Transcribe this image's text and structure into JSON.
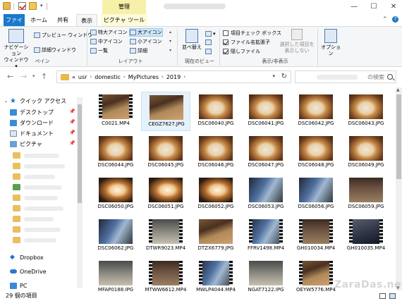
{
  "title_bar": {
    "manage_label": "管理",
    "window_buttons": [
      "—",
      "☐",
      "✕"
    ]
  },
  "ribbon_tabs": [
    {
      "label": "ファイル"
    },
    {
      "label": "ホーム"
    },
    {
      "label": "共有"
    },
    {
      "label": "表示"
    },
    {
      "label": "ピクチャ ツール"
    }
  ],
  "ribbon": {
    "pane_group": {
      "nav_pane": "ナビゲーション\nウィンドウ▾",
      "preview": "プレビュー ウィンドウ",
      "details": "詳細ウィンドウ",
      "label": "ペイン"
    },
    "layout_group": {
      "items": [
        "特大アイコン",
        "大アイコン",
        "中アイコン",
        "小アイコン",
        "一覧",
        "詳細"
      ],
      "label": "レイアウト"
    },
    "current_view_group": {
      "sort": "並べ替え",
      "label": "現在のビュー"
    },
    "show_hide_group": {
      "items": [
        {
          "label": "項目チェック ボックス",
          "checked": false
        },
        {
          "label": "ファイル名拡張子",
          "checked": true
        },
        {
          "label": "隠しファイル",
          "checked": true
        }
      ],
      "hide_selected": "選択した項目を\n表示しない",
      "label": "表示/非表示"
    },
    "options": "オプション"
  },
  "address": {
    "breadcrumbs": [
      "«",
      "usr",
      "domestic",
      "MyPictures",
      "2019"
    ],
    "search_placeholder": "の検索"
  },
  "nav_pane": {
    "quick_access": "クイック アクセス",
    "pinned": [
      {
        "label": "デスクトップ",
        "icon": "desktop-icon"
      },
      {
        "label": "ダウンロード",
        "icon": "download-icon"
      },
      {
        "label": "ドキュメント",
        "icon": "document-icon"
      },
      {
        "label": "ピクチャ",
        "icon": "picture-icon"
      }
    ],
    "dropbox": "Dropbox",
    "onedrive": "OneDrive",
    "pc": "PC"
  },
  "files": [
    {
      "name": "C0021.MP4",
      "kind": "film img"
    },
    {
      "name": "CEGZ7627.JPG",
      "kind": "img",
      "selected": true
    },
    {
      "name": "DSC06040.JPG",
      "kind": "plate"
    },
    {
      "name": "DSC06041.JPG",
      "kind": "plate"
    },
    {
      "name": "DSC06042.JPG",
      "kind": "plate"
    },
    {
      "name": "DSC06043.JPG",
      "kind": "plate"
    },
    {
      "name": "DSC06044.JPG",
      "kind": "plate"
    },
    {
      "name": "DSC06045.JPG",
      "kind": "plate"
    },
    {
      "name": "DSC06046.JPG",
      "kind": "plate"
    },
    {
      "name": "DSC06047.JPG",
      "kind": "plate"
    },
    {
      "name": "DSC06048.JPG",
      "kind": "plate"
    },
    {
      "name": "DSC06049.JPG",
      "kind": "plate"
    },
    {
      "name": "DSC06050.JPG",
      "kind": "plate2"
    },
    {
      "name": "DSC06051.JPG",
      "kind": "plate2"
    },
    {
      "name": "DSC06052.JPG",
      "kind": "plate2"
    },
    {
      "name": "DSC06053.JPG",
      "kind": "screen"
    },
    {
      "name": "DSC06056.JPG",
      "kind": "screen"
    },
    {
      "name": "DSC06059.JPG",
      "kind": "dark"
    },
    {
      "name": "DSC06062.JPG",
      "kind": "screen"
    },
    {
      "name": "DTWR9023.MP4",
      "kind": "film glass"
    },
    {
      "name": "DTZX6779.JPG",
      "kind": "img"
    },
    {
      "name": "FFRV1498.MP4",
      "kind": "film screen"
    },
    {
      "name": "GH010034.MP4",
      "kind": "film dark"
    },
    {
      "name": "GH010035.MP4",
      "kind": "film bag"
    },
    {
      "name": "MFAP0188.JPG",
      "kind": "glass"
    },
    {
      "name": "MTWW6612.MP4",
      "kind": "film dark"
    },
    {
      "name": "MWLP4044.MP4",
      "kind": "film screen"
    },
    {
      "name": "NGAT7122.JPG",
      "kind": "glass"
    },
    {
      "name": "OEYW5776.MP4",
      "kind": "film img"
    }
  ],
  "status": {
    "count": "29 個の項目"
  },
  "watermark": "ZaraDas.net"
}
